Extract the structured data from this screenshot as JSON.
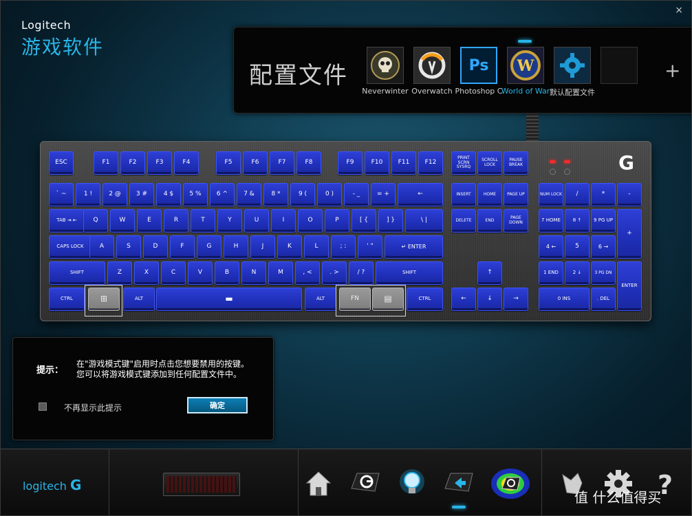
{
  "window": {
    "close_icon": "×"
  },
  "brand": {
    "line1": "Logitech",
    "line2": "游戏软件"
  },
  "profiles": {
    "title": "配置文件",
    "add_label": "+",
    "items": [
      {
        "label": "Neverwinter",
        "icon": "skull-icon"
      },
      {
        "label": "Overwatch",
        "icon": "overwatch-icon"
      },
      {
        "label": "Photoshop C",
        "icon": "photoshop-icon",
        "icon_text": "Ps"
      },
      {
        "label": "World of War",
        "icon": "wow-icon",
        "icon_text": "W"
      },
      {
        "label": "默认配置文件",
        "icon": "gear-icon"
      },
      {
        "label": "",
        "icon": "empty-slot-icon"
      }
    ]
  },
  "keyboard": {
    "logo": "G",
    "keys": {
      "esc": "ESC",
      "f1": "F1",
      "f2": "F2",
      "f3": "F3",
      "f4": "F4",
      "f5": "F5",
      "f6": "F6",
      "f7": "F7",
      "f8": "F8",
      "f9": "F9",
      "f10": "F10",
      "f11": "F11",
      "f12": "F12",
      "prtsc": "PRINT SCRN SYSRQ",
      "scroll": "SCROLL LOCK",
      "pause": "PAUSE BREAK",
      "grave": "` ~",
      "n1": "1 !",
      "n2": "2 @",
      "n3": "3 #",
      "n4": "4 $",
      "n5": "5 %",
      "n6": "6 ^",
      "n7": "7 &",
      "n8": "8 *",
      "n9": "9 (",
      "n0": "0 )",
      "minus": "- _",
      "equal": "= +",
      "backspace": "←",
      "insert": "INSERT",
      "home": "HOME",
      "pgup": "PAGE UP",
      "numlock": "NUM LOCK",
      "numslash": "/",
      "numstar": "*",
      "numminus": "-",
      "tab": "TAB ⇥ ⇤",
      "q": "Q",
      "w": "W",
      "e": "E",
      "r": "R",
      "t": "T",
      "y": "Y",
      "u": "U",
      "i": "I",
      "o": "O",
      "p": "P",
      "lbracket": "[ {",
      "rbracket": "] }",
      "backslash": "\\ |",
      "delete": "DELETE",
      "end": "END",
      "pgdn": "PAGE DOWN",
      "num7": "7 HOME",
      "num8": "8 ↑",
      "num9": "9 PG UP",
      "numplus": "+",
      "caps": "CAPS LOCK",
      "a": "A",
      "s": "S",
      "d": "D",
      "f": "F",
      "g": "G",
      "h": "H",
      "j": "J",
      "k": "K",
      "l": "L",
      "semicolon": "; :",
      "quote": "' \"",
      "enter": "↵ ENTER",
      "num4": "4 ←",
      "num5": "5",
      "num6": "6 →",
      "lshift": "SHIFT",
      "z": "Z",
      "x": "X",
      "c": "C",
      "v": "V",
      "b": "B",
      "n": "N",
      "m": "M",
      "comma": ", <",
      "period": ". >",
      "slash": "/ ?",
      "rshift": "SHIFT",
      "up": "↑",
      "num1": "1 END",
      "num2": "2 ↓",
      "num3": "3 PG DN",
      "numenter": "ENTER",
      "lctrl": "CTRL",
      "win": "⊞",
      "lalt": "ALT",
      "space": "▬",
      "ralt": "ALT",
      "fn": "FN",
      "menu": "▤",
      "rctrl": "CTRL",
      "left": "←",
      "down": "↓",
      "right": "→",
      "num0": "0 INS",
      "numdot": ". DEL"
    }
  },
  "tip": {
    "label": "提示：",
    "text": "在\"游戏模式键\"启用时点击您想要禁用的按键。您可以将游戏模式键添加到任何配置文件中。",
    "checkbox_label": "不再显示此提示",
    "ok_label": "确定"
  },
  "bottom": {
    "logo": "logitech",
    "watermark": "值 什么值得买",
    "icons": [
      "home-icon",
      "g-key-icon",
      "lighting-bulb-icon",
      "g-key-arrow-icon",
      "heatmap-icon",
      "arx-control-icon",
      "settings-gear-icon",
      "help-icon"
    ]
  },
  "colors": {
    "accent": "#29b5e8",
    "key_blue": "#1f2fb8",
    "led_red": "#ff2a2a"
  }
}
